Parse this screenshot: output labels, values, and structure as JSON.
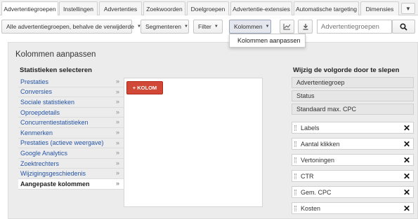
{
  "tabs": [
    {
      "label": "Advertentiegroepen",
      "active": true
    },
    {
      "label": "Instellingen"
    },
    {
      "label": "Advertenties"
    },
    {
      "label": "Zoekwoorden"
    },
    {
      "label": "Doelgroepen"
    },
    {
      "label": "Advertentie-extensies"
    },
    {
      "label": "Automatische targeting"
    },
    {
      "label": "Dimensies"
    }
  ],
  "tab_more_icon": "caret-down-icon",
  "toolbar": {
    "filter_scope": "Alle advertentiegroepen, behalve de verwijderde",
    "segment_label": "Segmenteren",
    "filter_label": "Filter",
    "columns_label": "Kolommen",
    "chart_icon": "line-chart-icon",
    "download_icon": "download-icon",
    "search_placeholder": "Advertentiegroepen",
    "search_icon": "search-icon"
  },
  "dropdown": {
    "item": "Kolommen aanpassen"
  },
  "panel": {
    "title": "Kolommen aanpassen",
    "stats_heading": "Statistieken selecteren",
    "order_heading": "Wijzig de volgorde door te slepen",
    "stats": [
      "Prestaties",
      "Conversies",
      "Sociale statistieken",
      "Oproepdetails",
      "Concurrentiestatistieken",
      "Kenmerken",
      "Prestaties (actieve weergave)",
      "Google Analytics",
      "Zoektrechters",
      "Wijzigingsgeschiedenis",
      "Aangepaste kolommen"
    ],
    "active_stat_index": 10,
    "add_column_label": "+ KOLOM",
    "fixed_columns": [
      "Advertentiegroep",
      "Status",
      "Standaard max. CPC"
    ],
    "movable_columns": [
      "Labels",
      "Aantal klikken",
      "Vertoningen",
      "CTR",
      "Gem. CPC",
      "Kosten"
    ],
    "accent_color": "#d14836",
    "link_color": "#2553a6"
  }
}
